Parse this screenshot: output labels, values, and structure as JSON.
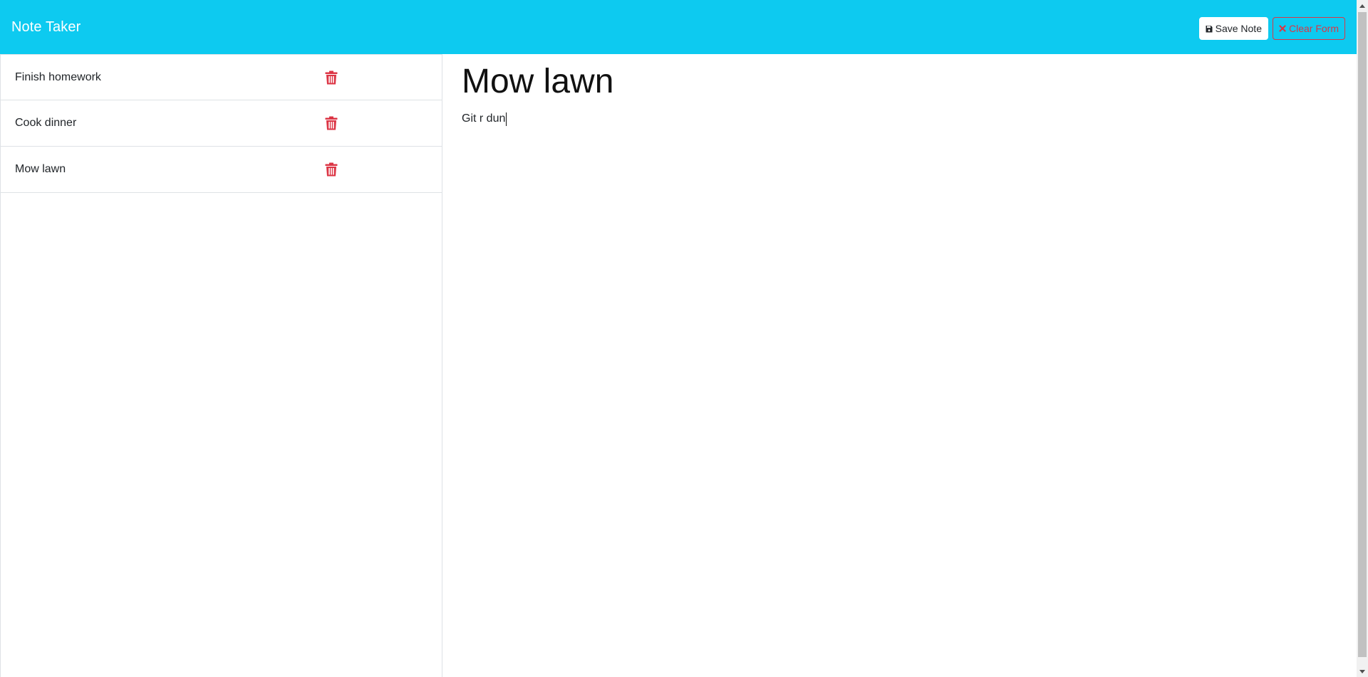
{
  "navbar": {
    "brand": "Note Taker",
    "save_label": "Save Note",
    "clear_label": "Clear Form",
    "colors": {
      "background": "#0dcaf0",
      "danger": "#dc3545"
    }
  },
  "sidebar": {
    "items": [
      {
        "label": "Finish homework",
        "delete_icon": "trash-icon"
      },
      {
        "label": "Cook dinner",
        "delete_icon": "trash-icon"
      },
      {
        "label": "Mow lawn",
        "delete_icon": "trash-icon"
      }
    ]
  },
  "editor": {
    "title": "Mow lawn",
    "text": "Git r dun"
  }
}
